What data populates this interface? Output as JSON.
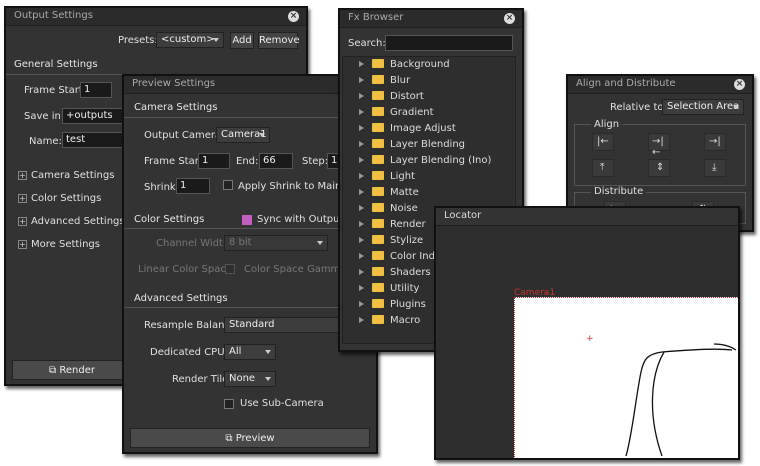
{
  "output_settings": {
    "title": "Output Settings",
    "presets_label": "Presets:",
    "presets_value": "<custom>",
    "add_label": "Add",
    "remove_label": "Remove",
    "general_header": "General Settings",
    "frame_start_label": "Frame Start:",
    "frame_start_value": "1",
    "save_in_label": "Save in:",
    "save_in_value": "+outputs",
    "name_label": "Name:",
    "name_value": "test",
    "sections": [
      "Camera Settings",
      "Color Settings",
      "Advanced Settings",
      "More Settings"
    ],
    "render_label": "Render"
  },
  "preview_settings": {
    "title": "Preview Settings",
    "camera_header": "Camera Settings",
    "output_camera_label": "Output Camera:",
    "output_camera_value": "Camera1",
    "frame_start_label": "Frame Start:",
    "frame_start_value": "1",
    "end_label": "End:",
    "end_value": "66",
    "step_label": "Step:",
    "step_value": "1",
    "shrink_label": "Shrink:",
    "shrink_value": "1",
    "apply_shrink_label": "Apply Shrink to Main V",
    "color_header": "Color Settings",
    "sync_label": "Sync with Output S",
    "channel_width_label": "Channel Width:",
    "channel_width_value": "8 bit",
    "linear_label": "Linear Color Space:",
    "gamma_label": "Color Space Gamma:",
    "advanced_header": "Advanced Settings",
    "resample_label": "Resample Balance:",
    "resample_value": "Standard",
    "cpus_label": "Dedicated CPUs:",
    "cpus_value": "All",
    "tile_label": "Render Tile:",
    "tile_value": "None",
    "subcam_label": "Use Sub-Camera",
    "preview_label": "Preview"
  },
  "fx_browser": {
    "title": "Fx Browser",
    "search_label": "Search:",
    "search_value": "",
    "items": [
      "Background",
      "Blur",
      "Distort",
      "Gradient",
      "Image Adjust",
      "Layer Blending",
      "Layer Blending (Ino)",
      "Light",
      "Matte",
      "Noise",
      "Render",
      "Stylize",
      "Color Inde",
      "Shaders",
      "Utility",
      "Plugins",
      "Macro"
    ]
  },
  "align": {
    "title": "Align and Distribute",
    "relative_label": "Relative to:",
    "relative_value": "Selection Area",
    "align_header": "Align",
    "distribute_header": "Distribute"
  },
  "locator": {
    "title": "Locator",
    "camera_label": "Camera1"
  }
}
